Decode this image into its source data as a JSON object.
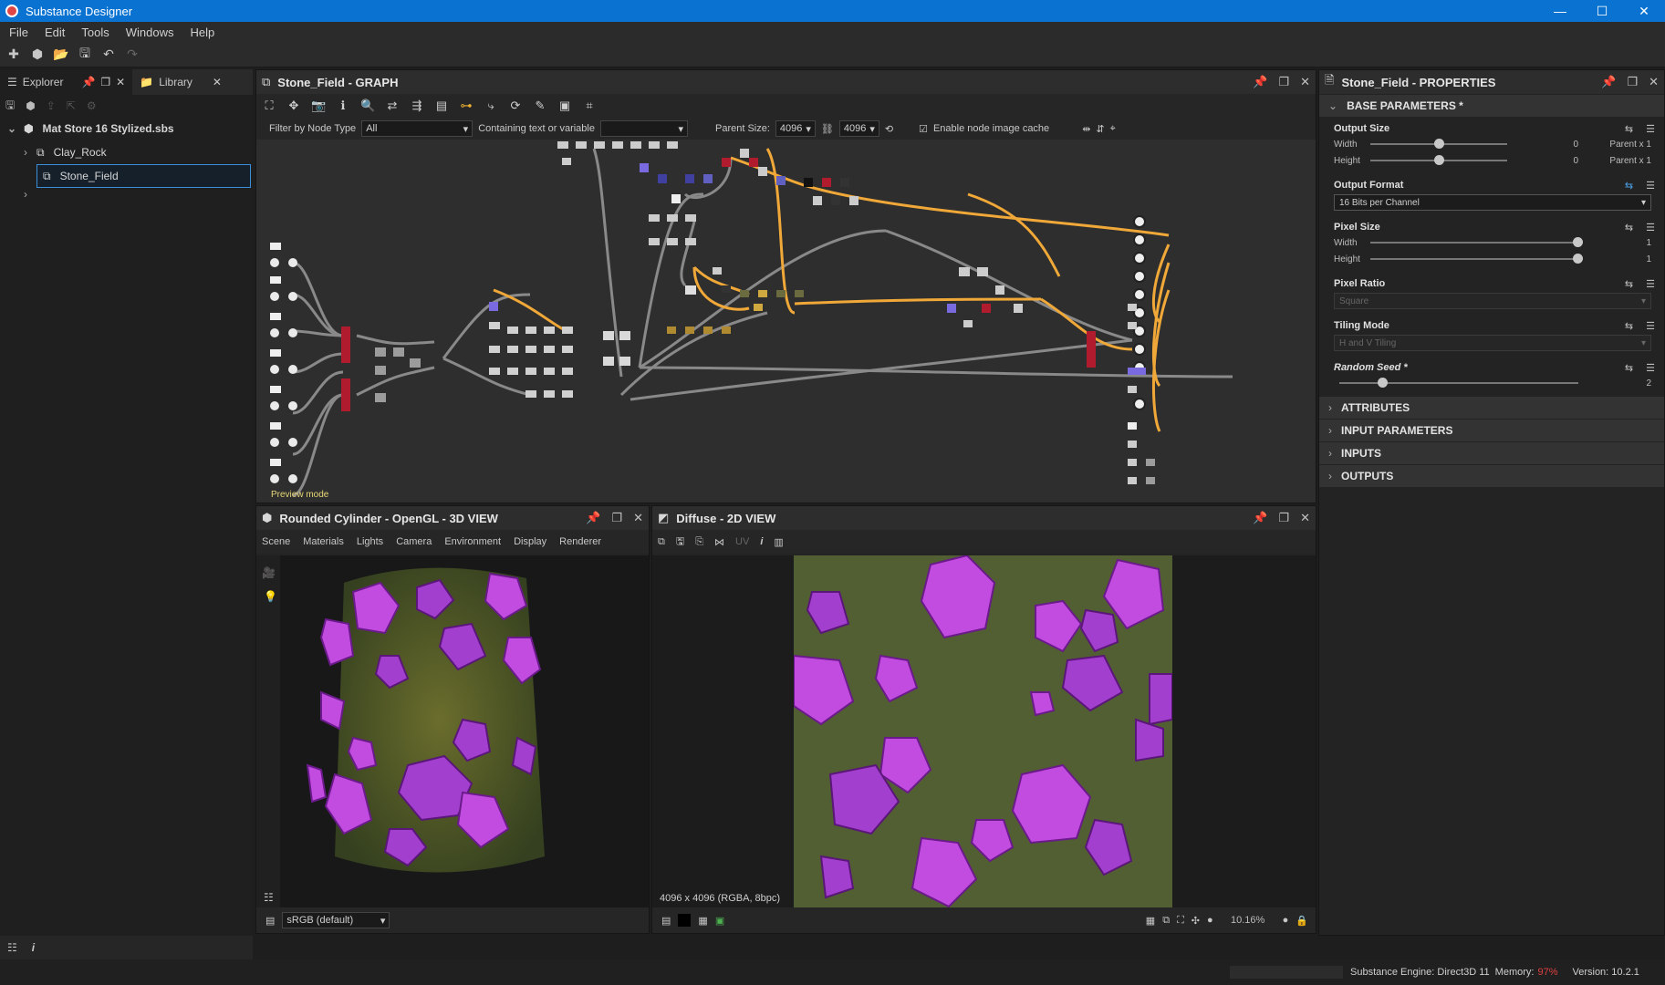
{
  "window": {
    "title": "Substance Designer",
    "controls": [
      "—",
      "☐",
      "✕"
    ]
  },
  "menu": [
    "File",
    "Edit",
    "Tools",
    "Windows",
    "Help"
  ],
  "explorer": {
    "tab_explorer": "Explorer",
    "tab_library": "Library",
    "package": "Mat Store 16 Stylized.sbs",
    "graphs": [
      "Clay_Rock",
      "Stone_Field"
    ]
  },
  "graph": {
    "title": "Stone_Field - GRAPH",
    "filter_label": "Filter by Node Type",
    "filter_value": "All",
    "containing_label": "Containing text or variable",
    "parent_size_label": "Parent Size:",
    "parent_size_w": "4096",
    "parent_size_h": "4096",
    "cache_label": "Enable node image cache",
    "cache_checked": true,
    "preview_mode": "Preview mode"
  },
  "view3d": {
    "title": "Rounded Cylinder - OpenGL - 3D VIEW",
    "menus": [
      "Scene",
      "Materials",
      "Lights",
      "Camera",
      "Environment",
      "Display",
      "Renderer"
    ],
    "colorspace": "sRGB (default)"
  },
  "view2d": {
    "title": "Diffuse - 2D VIEW",
    "uv_label": "UV",
    "image_info": "4096 x 4096 (RGBA, 8bpc)",
    "zoom": "10.16%"
  },
  "properties": {
    "title": "Stone_Field - PROPERTIES",
    "base_parameters": "BASE PARAMETERS *",
    "output_size": {
      "label": "Output Size",
      "width_label": "Width",
      "width_value": "0",
      "width_rel": "Parent x 1",
      "height_label": "Height",
      "height_value": "0",
      "height_rel": "Parent x 1",
      "width_knob": 0.5,
      "height_knob": 0.5
    },
    "output_format": {
      "label": "Output Format",
      "value": "16 Bits per Channel"
    },
    "pixel_size": {
      "label": "Pixel Size",
      "width_label": "Width",
      "width_value": "1",
      "height_label": "Height",
      "height_value": "1"
    },
    "pixel_ratio": {
      "label": "Pixel Ratio",
      "value": "Square"
    },
    "tiling_mode": {
      "label": "Tiling Mode",
      "value": "H and V Tiling"
    },
    "random_seed": {
      "label": "Random Seed *",
      "value": "2",
      "knob": 0.18
    },
    "sections": [
      "ATTRIBUTES",
      "INPUT PARAMETERS",
      "INPUTS",
      "OUTPUTS"
    ]
  },
  "status": {
    "engine": "Substance Engine: Direct3D 11",
    "memory_label": "Memory:",
    "memory_value": "97%",
    "version": "Version: 10.2.1",
    "memory_color": "#e04040"
  }
}
